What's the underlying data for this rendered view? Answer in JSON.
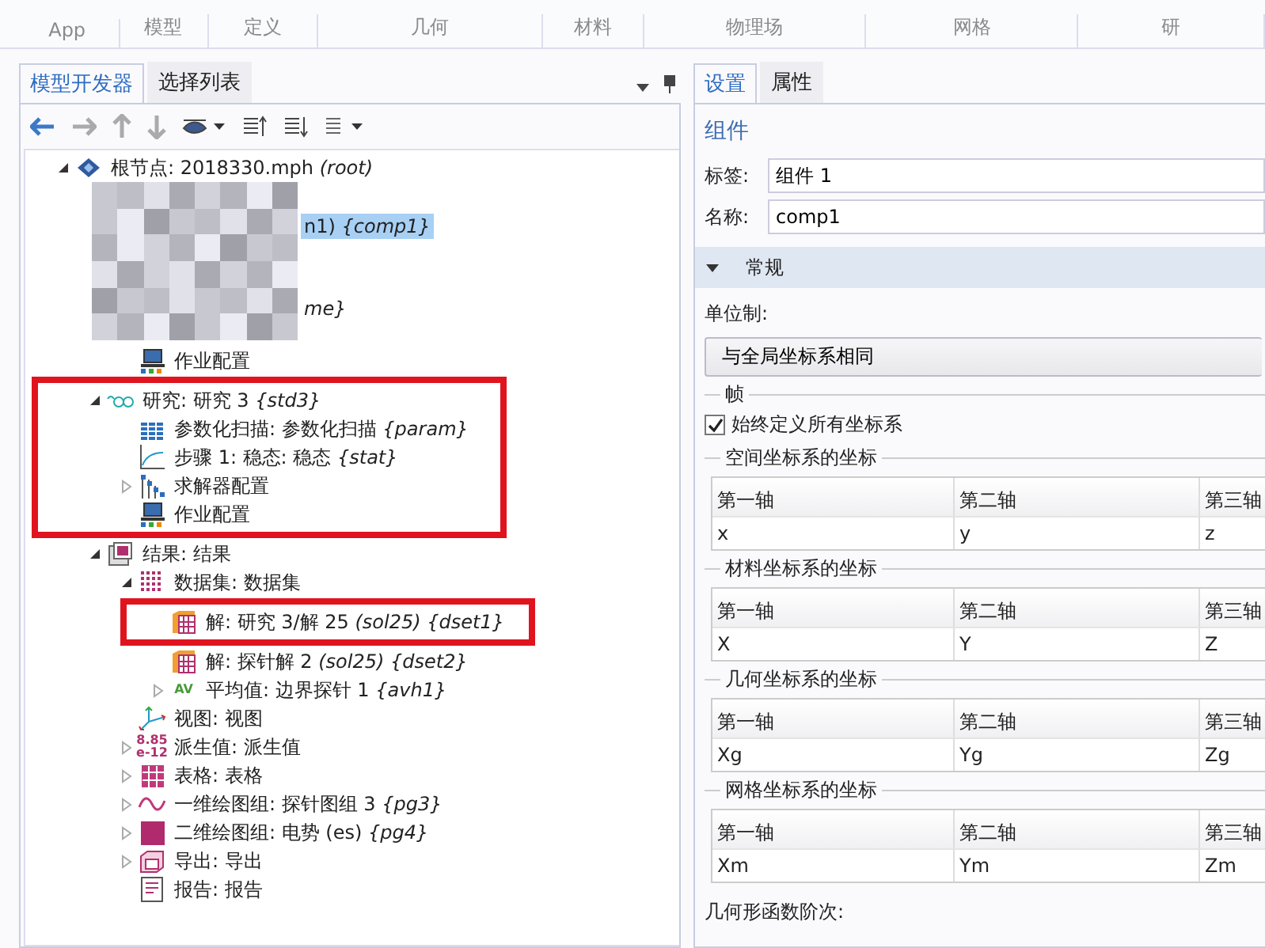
{
  "ribbon": {
    "groups": [
      "App",
      "模型",
      "定义",
      "几何",
      "材料",
      "物理场",
      "网格",
      "研"
    ]
  },
  "model_builder": {
    "tabs": [
      {
        "label": "模型开发器",
        "selected": true
      },
      {
        "label": "选择列表",
        "selected": false
      }
    ],
    "tree": [
      {
        "kind": "root",
        "label": "根节点: 2018330.mph *(root)*",
        "expanded": true,
        "children": [
          {
            "kind": "redacted",
            "fragments": [
              {
                "text": "n1) *{comp1}*",
                "selected": true
              },
              {
                "text": "*me}*",
                "selected": false
              }
            ],
            "children": [
              {
                "kind": "job",
                "label": "作业配置"
              }
            ]
          },
          {
            "kind": "study",
            "label": "研究: 研究 3 *{std3}*",
            "expanded": true,
            "highlighted": true,
            "children": [
              {
                "kind": "sweep",
                "label": "参数化扫描: 参数化扫描 *{param}*"
              },
              {
                "kind": "step",
                "label": "步骤 1: 稳态: 稳态 *{stat}*"
              },
              {
                "kind": "solver",
                "label": "求解器配置",
                "expanded": false
              },
              {
                "kind": "job",
                "label": "作业配置"
              }
            ]
          },
          {
            "kind": "results",
            "label": "结果: 结果",
            "expanded": true,
            "children": [
              {
                "kind": "dataset",
                "label": "数据集: 数据集",
                "expanded": true,
                "children": [
                  {
                    "kind": "solution",
                    "label": "解: 研究 3/解 25 *(sol25) {dset1}*",
                    "highlighted": true
                  },
                  {
                    "kind": "solution",
                    "label": "解: 探针解 2 *(sol25) {dset2}*"
                  },
                  {
                    "kind": "average",
                    "icon_text": "AV",
                    "label": "平均值: 边界探针 1 *{avh1}*",
                    "expanded": false
                  }
                ]
              },
              {
                "kind": "view",
                "label": "视图: 视图"
              },
              {
                "kind": "derived",
                "icon_text": "8.85 e-12",
                "label": "派生值: 派生值",
                "expanded": false
              },
              {
                "kind": "table",
                "label": "表格: 表格",
                "expanded": false
              },
              {
                "kind": "plot1d",
                "label": "一维绘图组: 探针图组 3 *{pg3}*",
                "expanded": false
              },
              {
                "kind": "plot2d",
                "label": "二维绘图组: 电势 (es) *{pg4}*",
                "expanded": false
              },
              {
                "kind": "export",
                "label": "导出: 导出",
                "expanded": false
              },
              {
                "kind": "report",
                "label": "报告: 报告"
              }
            ]
          }
        ]
      }
    ]
  },
  "settings": {
    "tabs": [
      {
        "label": "设置",
        "selected": true
      },
      {
        "label": "属性",
        "selected": false
      }
    ],
    "heading": "组件",
    "fields": [
      {
        "label": "标签:",
        "value": "组件 1"
      },
      {
        "label": "名称:",
        "value": "comp1"
      }
    ],
    "section": {
      "title": "常规",
      "expanded": true
    },
    "unit_label": "单位制:",
    "unit_dropdown": "与全局坐标系相同",
    "frame_group": "帧",
    "checkbox": {
      "label": "始终定义所有坐标系",
      "checked": true
    },
    "coordinate_groups": [
      {
        "title": "空间坐标系的坐标",
        "columns": [
          "第一轴",
          "第二轴",
          "第三轴"
        ],
        "values": [
          "x",
          "y",
          "z"
        ]
      },
      {
        "title": "材料坐标系的坐标",
        "columns": [
          "第一轴",
          "第二轴",
          "第三轴"
        ],
        "values": [
          "X",
          "Y",
          "Z"
        ]
      },
      {
        "title": "几何坐标系的坐标",
        "columns": [
          "第一轴",
          "第二轴",
          "第三轴"
        ],
        "values": [
          "Xg",
          "Yg",
          "Zg"
        ]
      },
      {
        "title": "网格坐标系的坐标",
        "columns": [
          "第一轴",
          "第二轴",
          "第三轴"
        ],
        "values": [
          "Xm",
          "Ym",
          "Zm"
        ]
      }
    ],
    "shape_order_label": "几何形函数阶次:"
  }
}
